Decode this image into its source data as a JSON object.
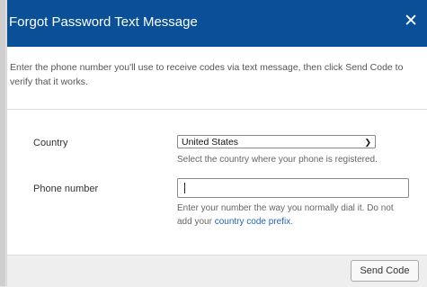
{
  "dialog": {
    "title": "Forgot Password Text Message",
    "close_label": "✕",
    "instructions_line1": "Enter the phone number you'll use to receive codes via text message, then click Send Code to",
    "instructions_line2": "verify that it works."
  },
  "form": {
    "country": {
      "label": "Country",
      "selected_value": "United States",
      "help": "Select the country where your phone is registered."
    },
    "phone": {
      "label": "Phone number",
      "value": "",
      "help_line1": "Enter your number the way you normally dial it. Do not",
      "help_line2_prefix": "add your ",
      "help_link": "country code prefix",
      "help_line2_suffix": "."
    }
  },
  "footer": {
    "send_code_label": "Send Code"
  },
  "colors": {
    "header_bg": "#0a5099",
    "link": "#1f63b5",
    "footer_bg": "#eeeeee"
  },
  "icons": {
    "close": "close-icon",
    "dropdown": "chevron-down-icon"
  }
}
